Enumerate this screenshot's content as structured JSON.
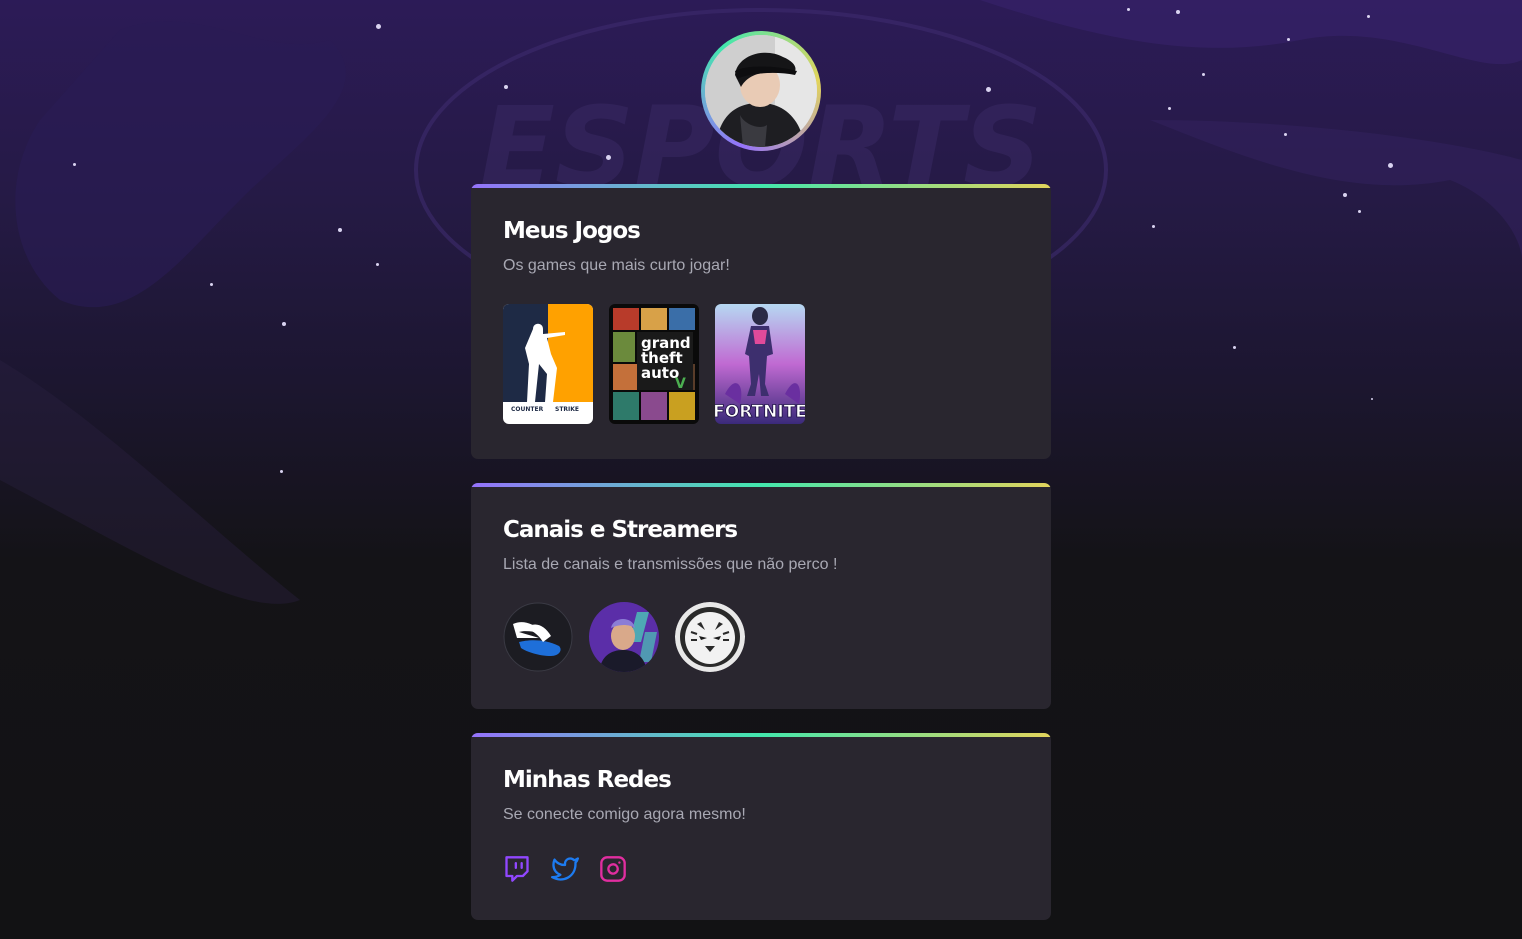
{
  "profile": {
    "avatar_icon": "profile-photo"
  },
  "sections": {
    "games": {
      "title": "Meus Jogos",
      "subtitle": "Os games que mais curto jogar!",
      "items": [
        {
          "name": "Counter Strike",
          "label_left": "COUNTER",
          "label_right": "STRIKE"
        },
        {
          "name": "Grand Theft Auto",
          "line1": "grand",
          "line2": "theft",
          "line3": "auto"
        },
        {
          "name": "Fortnite",
          "label": "FORTNITE"
        }
      ]
    },
    "channels": {
      "title": "Canais e Streamers",
      "subtitle": "Lista de canais e transmissões que não perco !",
      "items": [
        {
          "icon": "winged-shoe-logo-icon"
        },
        {
          "icon": "streamer-photo-icon"
        },
        {
          "icon": "tiger-logo-icon"
        }
      ]
    },
    "socials": {
      "title": "Minhas Redes",
      "subtitle": "Se conecte comigo agora mesmo!",
      "items": [
        {
          "icon": "twitch-icon",
          "color": "#9147ff"
        },
        {
          "icon": "twitter-icon",
          "color": "#1d7bf0"
        },
        {
          "icon": "instagram-icon",
          "color": "#e12ea0"
        }
      ]
    }
  },
  "colors": {
    "card_bg": "#29262f",
    "gradient_start": "#9572fc",
    "gradient_mid": "#43e7ad",
    "gradient_end": "#e2d45c",
    "subtitle": "#a8a8b3"
  }
}
